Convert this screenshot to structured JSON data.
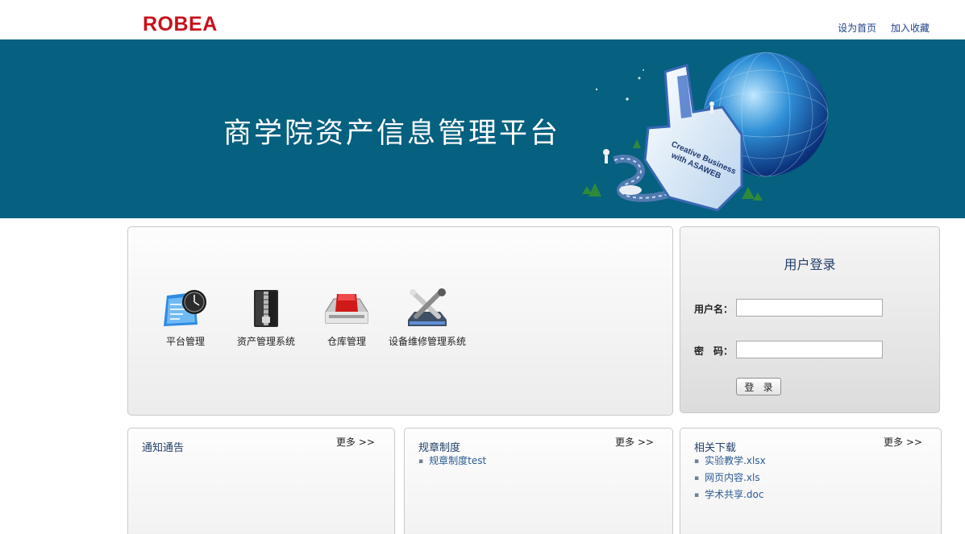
{
  "header": {
    "logo": "ROBEA",
    "links": [
      "设为首页",
      "加入收藏"
    ]
  },
  "banner": {
    "title": "商学院资产信息管理平台",
    "art_text": [
      "Creative Business",
      "with ASAWEB"
    ]
  },
  "apps": [
    {
      "label": "平台管理",
      "icon": "clock-calendar-icon"
    },
    {
      "label": "资产管理系统",
      "icon": "archive-zip-icon"
    },
    {
      "label": "仓库管理",
      "icon": "warehouse-tray-icon"
    },
    {
      "label": "设备维修管理系统",
      "icon": "tools-icon"
    }
  ],
  "login": {
    "title": "用户登录",
    "username_label": "用户名：",
    "password_label": "密　码：",
    "username_value": "",
    "password_value": "",
    "button": "登 录"
  },
  "sections": [
    {
      "title": "通知通告",
      "more": "更多 >>",
      "items": []
    },
    {
      "title": "规章制度",
      "more": "更多 >>",
      "items": [
        "规章制度test"
      ]
    },
    {
      "title": "相关下载",
      "more": "更多 >>",
      "items": [
        "实验教学.xlsx",
        "网页内容.xls",
        "学术共享.doc"
      ]
    }
  ],
  "colors": {
    "banner_bg": "#06607f",
    "logo_red": "#c8101b",
    "link_blue": "#1e3f8a",
    "title_blue": "#23406a"
  }
}
